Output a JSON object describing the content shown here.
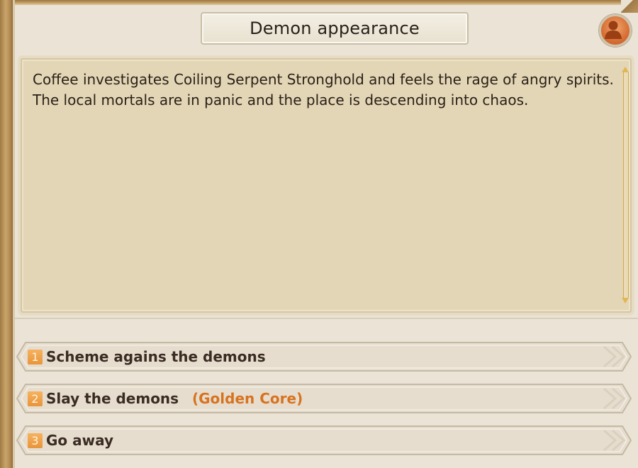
{
  "title": "Demon appearance",
  "profile_icon": "person-icon",
  "description": {
    "line1": "Coffee investigates Coiling Serpent Stronghold and feels the rage of angry spirits.",
    "line2": "The local mortals are in panic and the place is descending into chaos."
  },
  "options": [
    {
      "number": "1",
      "label": "Scheme agains the demons",
      "requirement": ""
    },
    {
      "number": "2",
      "label": "Slay the demons",
      "requirement": "(Golden Core)"
    },
    {
      "number": "3",
      "label": "Go away",
      "requirement": ""
    }
  ],
  "colors": {
    "accent": "#e8953a",
    "requirement": "#d7731f",
    "text": "#2b2118"
  }
}
